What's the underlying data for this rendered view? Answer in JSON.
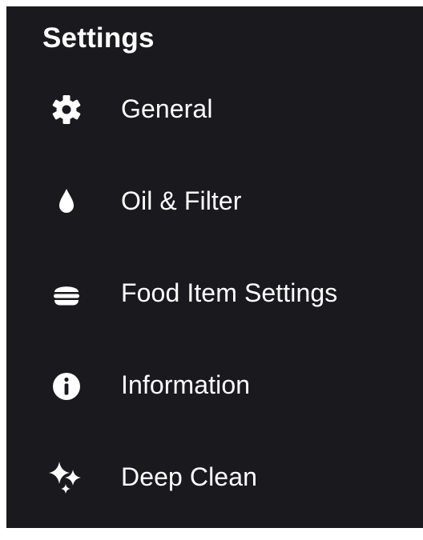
{
  "header": {
    "title": "Settings"
  },
  "menu": {
    "items": [
      {
        "label": "General",
        "icon": "gear-icon"
      },
      {
        "label": "Oil & Filter",
        "icon": "oil-drop-icon"
      },
      {
        "label": "Food Item Settings",
        "icon": "burger-icon"
      },
      {
        "label": "Information",
        "icon": "info-icon"
      },
      {
        "label": "Deep Clean",
        "icon": "sparkles-icon"
      }
    ]
  },
  "colors": {
    "background": "#1a191e",
    "text": "#ffffff"
  }
}
